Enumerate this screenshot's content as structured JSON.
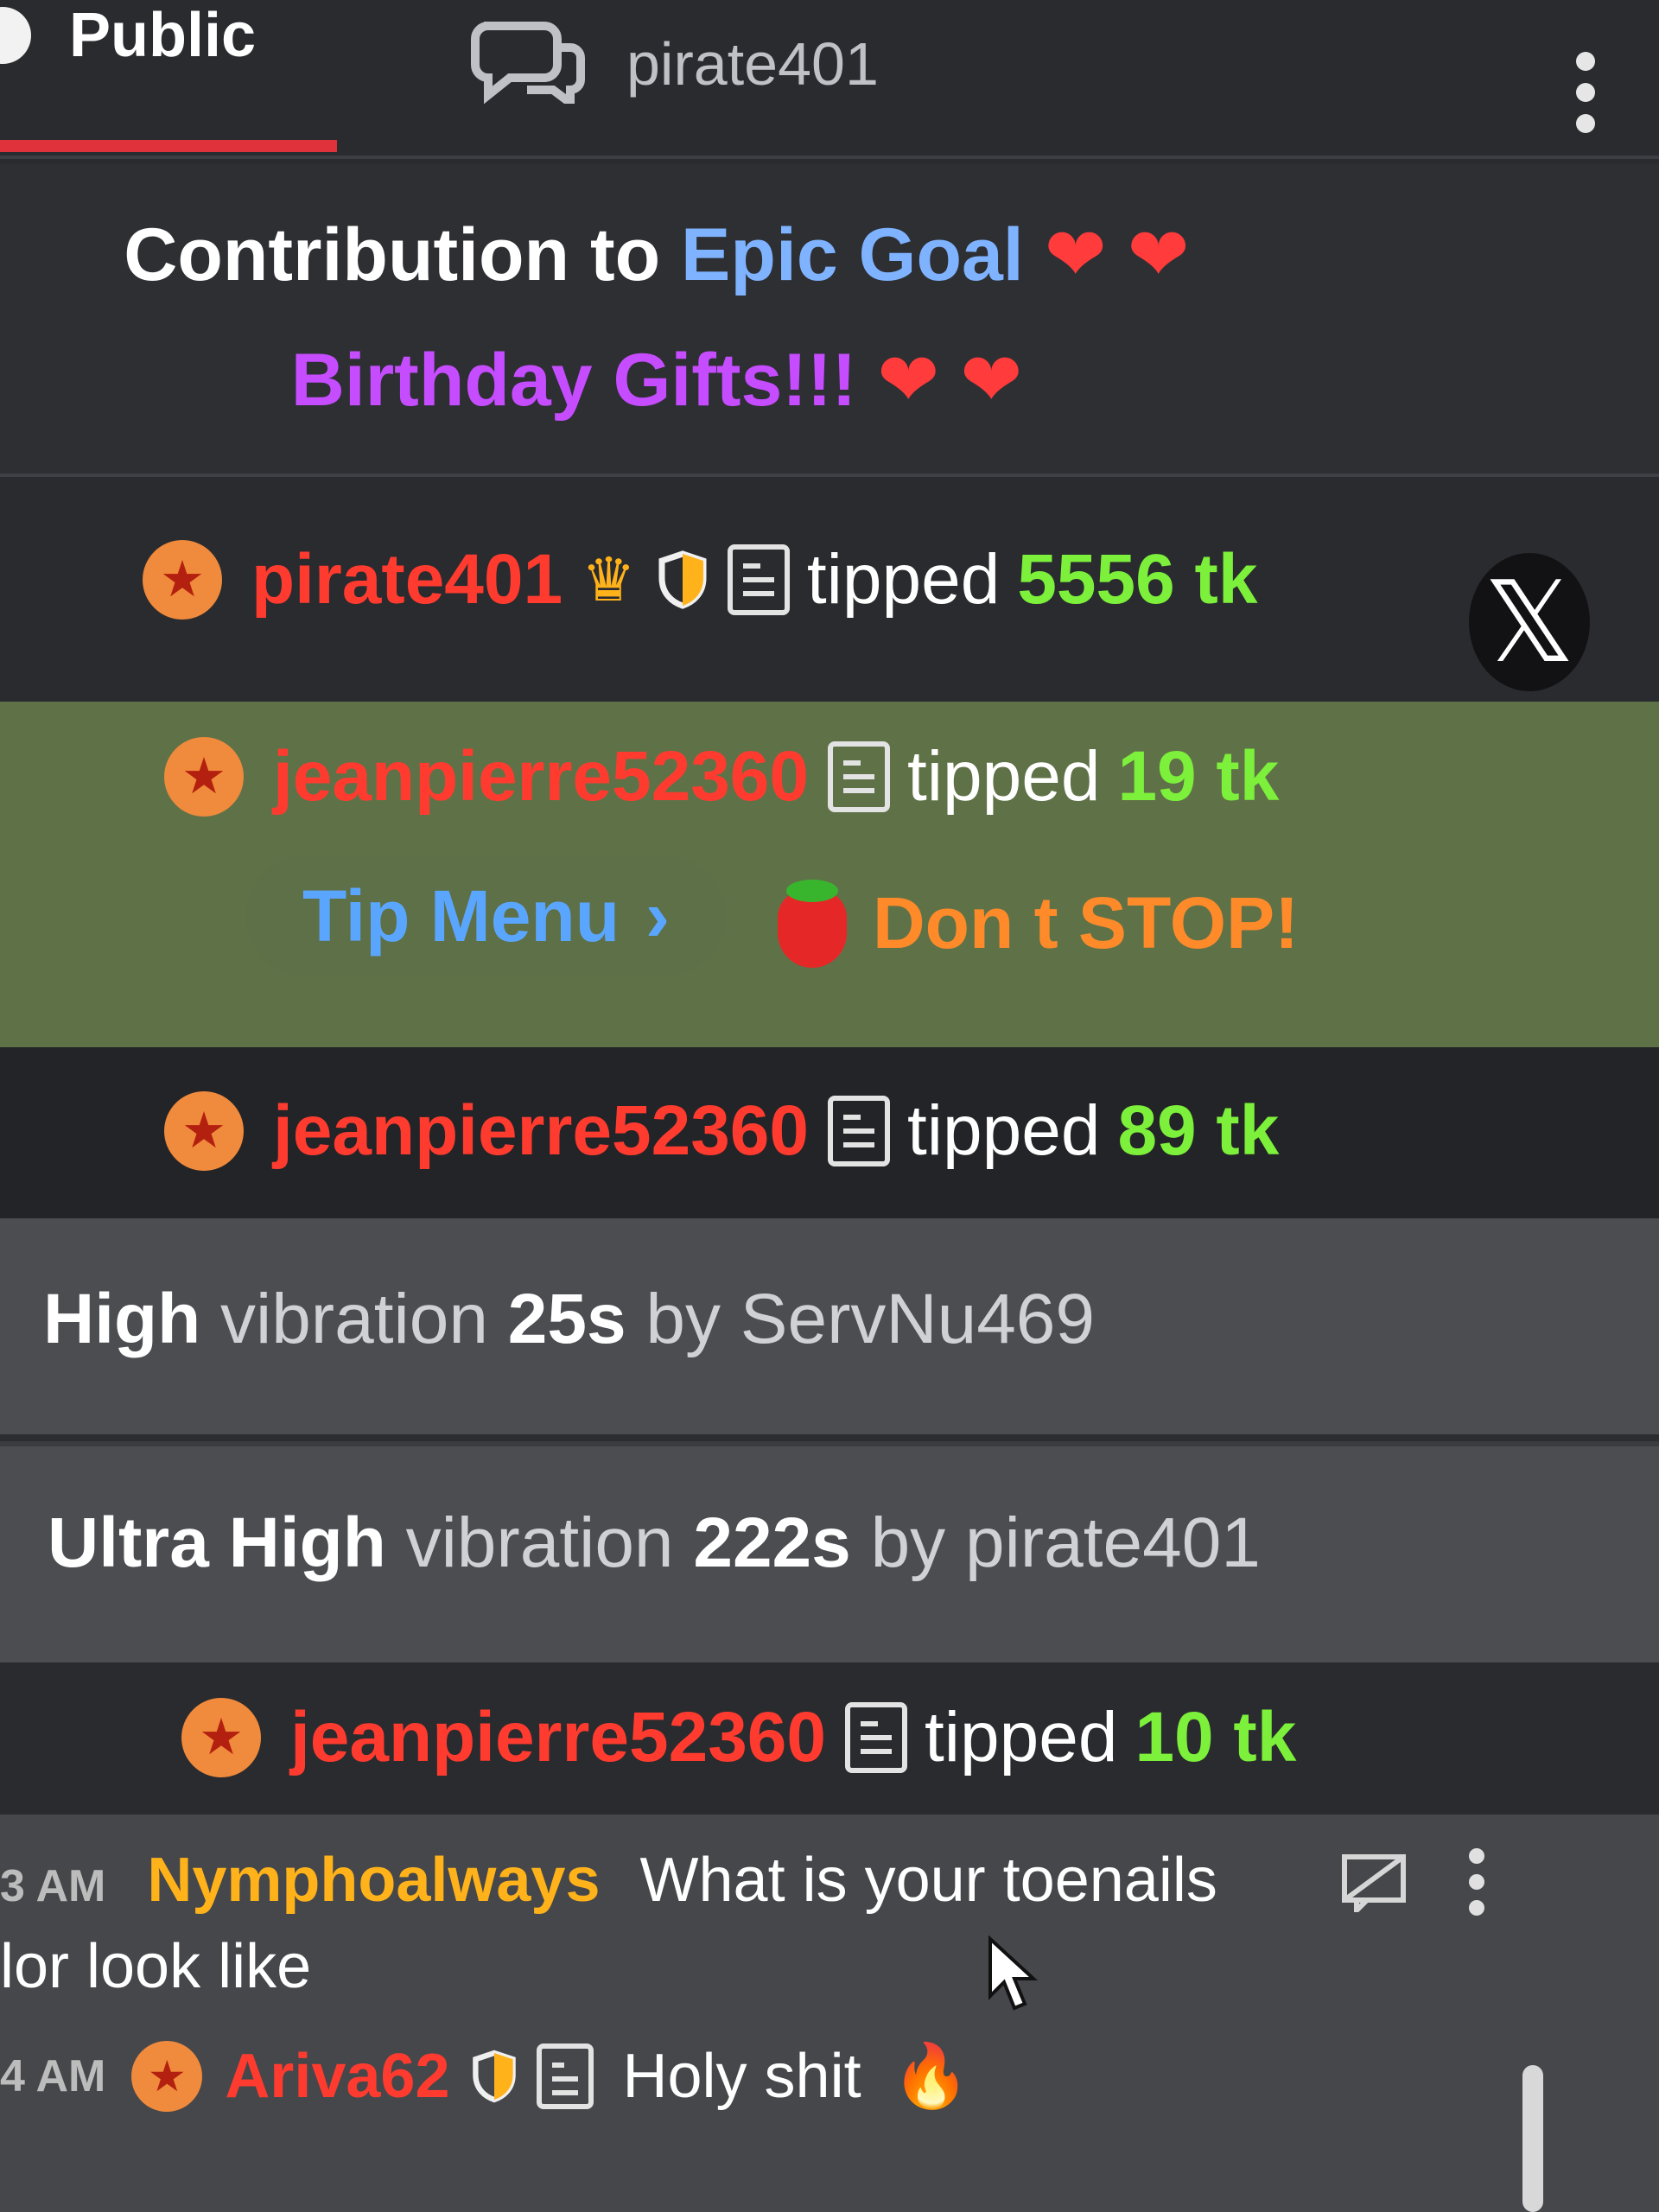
{
  "tabs": {
    "public_label": "Public",
    "pm_label": "pirate401"
  },
  "goal": {
    "prefix": "Contribution to ",
    "goal_name": "Epic Goal",
    "hearts": "❤ ❤",
    "line2": "Birthday Gifts!!!",
    "hearts2": "❤ ❤"
  },
  "tips": [
    {
      "user": "pirate401",
      "verb": "tipped",
      "amount": "5556 tk"
    },
    {
      "user": "jeanpierre52360",
      "verb": "tipped",
      "amount": "19 tk"
    },
    {
      "user": "jeanpierre52360",
      "verb": "tipped",
      "amount": "89 tk"
    },
    {
      "user": "jeanpierre52360",
      "verb": "tipped",
      "amount": "10 tk"
    }
  ],
  "tip_menu": {
    "label": "Tip Menu",
    "chevron": "›",
    "note": "Don t STOP!"
  },
  "close_glyph": "𝕏",
  "vibrations": [
    {
      "level": "High",
      "word": "vibration",
      "duration": "25s",
      "by": "by",
      "user": "ServNu469"
    },
    {
      "level": "Ultra High",
      "word": "vibration",
      "duration": "222s",
      "by": "by",
      "user": "pirate401"
    }
  ],
  "chat": {
    "messages": [
      {
        "time": "3 AM",
        "user": "Nymphoalways",
        "text_line1": "What is your toenails",
        "text_line2": "lor look like"
      },
      {
        "time": "4 AM",
        "user": "Ariva62",
        "text": "Holy shit",
        "emoji": "🔥"
      }
    ]
  },
  "colors": {
    "accent_red": "#e0323b",
    "username_red": "#ff3b2f",
    "amount_green": "#7cf03a",
    "goal_blue": "#7fb3ff",
    "goal_purple": "#c64cff",
    "highlight_row": "#5f7247"
  },
  "icons": [
    "check-icon",
    "chat-bubbles-icon",
    "kebab-menu-icon",
    "star-badge-icon",
    "crown-icon",
    "shield-icon",
    "document-icon",
    "x-close-icon",
    "strawberry-icon",
    "translate-icon",
    "fire-icon",
    "cursor-icon"
  ]
}
